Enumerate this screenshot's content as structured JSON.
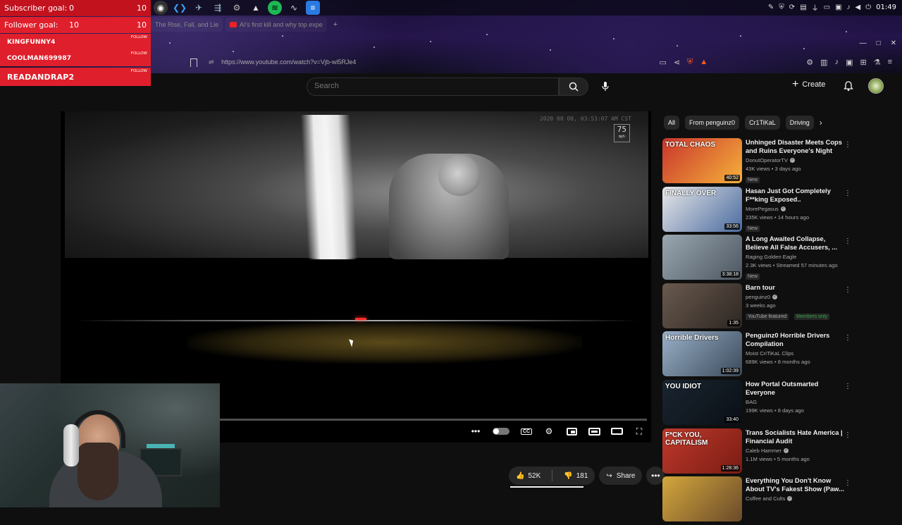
{
  "overlay": {
    "subscriber_goal": {
      "label": "Subscriber goal:",
      "current": "0",
      "max": "10"
    },
    "follower_goal": {
      "label": "Follower goal:",
      "current": "10",
      "max": "10"
    },
    "followers": [
      {
        "name": "KINGFUNNY4",
        "tag": "FOLLOW"
      },
      {
        "name": "COOLMAN699987",
        "tag": "FOLLOW"
      },
      {
        "name": "READANDRAP2",
        "tag": "FOLLOW"
      }
    ]
  },
  "taskbar": {
    "clock": "01:49",
    "apps": [
      "obs-icon",
      "vscode-icon",
      "steam-icon",
      "remote-icon",
      "tool-icon",
      "terminal-icon",
      "spotify-icon",
      "chart-app-icon",
      "docs-icon"
    ]
  },
  "browser": {
    "tabs": [
      {
        "title": "The Rise, Fall, and Lie"
      },
      {
        "title": "AI's first kill and why top expe"
      }
    ],
    "url": "https://www.youtube.com/watch?v=Vjb-wl5RJe4",
    "accent": "#ff5a1f"
  },
  "youtube": {
    "search_placeholder": "Search",
    "create_label": "Create"
  },
  "video": {
    "timestamp": "2020 08 08, 03:53:07 AM CST",
    "speed_value": "75",
    "speed_unit": "mph",
    "progress_fraction": 0.0,
    "cc_label": "CC"
  },
  "actions": {
    "likes": "52K",
    "dislikes": "181",
    "share_label": "Share"
  },
  "chips": [
    "All",
    "From penguinz0",
    "Cr1TiKaL",
    "Driving"
  ],
  "recommendations": [
    {
      "title": "Unhinged Disaster Meets Cops and Ruins Everyone's Night",
      "channel": "DonutOperatorTV",
      "verified": true,
      "meta": "43K views • 3 days ago",
      "badge": "New",
      "duration": "40:52",
      "thumb": "TOTAL CHAOS",
      "colors": [
        "#c9352c",
        "#f6b13b"
      ]
    },
    {
      "title": "Hasan Just Got Completely F**king Exposed..",
      "channel": "MorePegasus",
      "verified": true,
      "meta": "235K views • 14 hours ago",
      "badge": "New",
      "duration": "33:56",
      "thumb": "FINALLY OVER",
      "colors": [
        "#e8e8e8",
        "#4a6ba0"
      ]
    },
    {
      "title": "A Long Awaited Collapse, Believe All False Accusers, ...",
      "channel": "Raging Golden Eagle",
      "verified": false,
      "meta": "2.3K views • Streamed 57 minutes ago",
      "badge": "New",
      "duration": "3:38:18",
      "thumb": "",
      "colors": [
        "#9aa7b0",
        "#4c5660"
      ]
    },
    {
      "title": "Barn tour",
      "channel": "penguinz0",
      "verified": true,
      "meta": "3 weeks ago",
      "badge": "YouTube featured",
      "members": "Members only",
      "duration": "1:35",
      "thumb": "",
      "colors": [
        "#6a5a4e",
        "#2c2622"
      ]
    },
    {
      "title": "Penguinz0 Horrible Drivers Compilation",
      "channel": "Moist CriTiKaL Clips",
      "verified": false,
      "meta": "689K views • 8 months ago",
      "badge": "",
      "duration": "1:02:39",
      "thumb": "Horrible Drivers",
      "colors": [
        "#9ab0c8",
        "#3a4a5a"
      ]
    },
    {
      "title": "How Portal Outsmarted Everyone",
      "channel": "BAG",
      "verified": false,
      "meta": "199K views • 8 days ago",
      "badge": "",
      "duration": "33:40",
      "thumb": "YOU IDIOT",
      "colors": [
        "#1a2530",
        "#0a0f15"
      ]
    },
    {
      "title": "Trans Socialists Hate America | Financial Audit",
      "channel": "Caleb Hammer",
      "verified": true,
      "meta": "1.1M views • 5 months ago",
      "badge": "",
      "duration": "1:28:36",
      "thumb": "F*CK YOU, CAPITALISM",
      "colors": [
        "#c0392b",
        "#7a1c14"
      ]
    },
    {
      "title": "Everything You Don't Know About TV's Fakest Show (Paw...",
      "channel": "Coffee and Cults",
      "verified": true,
      "meta": "",
      "badge": "",
      "duration": "",
      "thumb": "",
      "colors": [
        "#d4a73c",
        "#6a4a2a"
      ]
    }
  ]
}
